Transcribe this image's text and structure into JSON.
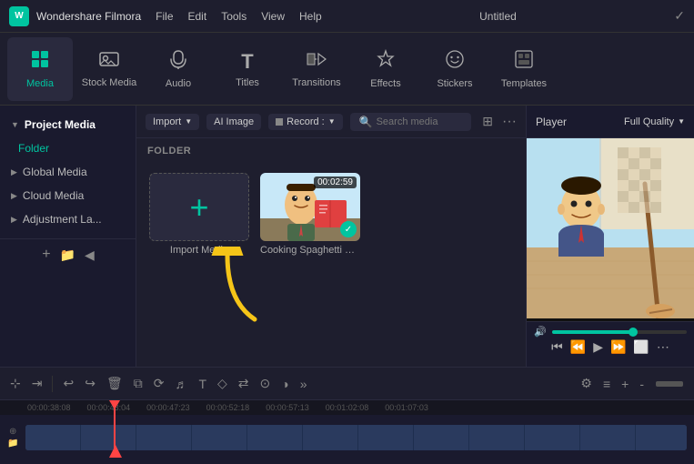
{
  "titlebar": {
    "logo": "W",
    "app_name": "Wondershare Filmora",
    "menu": [
      "File",
      "Edit",
      "Tools",
      "View",
      "Help"
    ],
    "title": "Untitled",
    "verified_icon": "✓"
  },
  "toolbar": {
    "items": [
      {
        "id": "media",
        "icon": "▦",
        "label": "Media",
        "active": true
      },
      {
        "id": "stock_media",
        "icon": "🖼",
        "label": "Stock Media",
        "active": false
      },
      {
        "id": "audio",
        "icon": "♪",
        "label": "Audio",
        "active": false
      },
      {
        "id": "titles",
        "icon": "T",
        "label": "Titles",
        "active": false
      },
      {
        "id": "transitions",
        "icon": "↔",
        "label": "Transitions",
        "active": false
      },
      {
        "id": "effects",
        "icon": "✦",
        "label": "Effects",
        "active": false
      },
      {
        "id": "stickers",
        "icon": "★",
        "label": "Stickers",
        "active": false
      },
      {
        "id": "templates",
        "icon": "⊟",
        "label": "Templates",
        "active": false
      }
    ]
  },
  "sidebar": {
    "sections": [
      {
        "id": "project_media",
        "label": "Project Media",
        "active": true
      },
      {
        "id": "global_media",
        "label": "Global Media"
      },
      {
        "id": "cloud_media",
        "label": "Cloud Media"
      },
      {
        "id": "adjustment",
        "label": "Adjustment La..."
      }
    ],
    "active_sub": "Folder"
  },
  "content_toolbar": {
    "import_label": "Import",
    "ai_image_label": "AI Image",
    "record_label": "Record :",
    "search_placeholder": "Search media",
    "folder_section": "FOLDER"
  },
  "media_items": [
    {
      "id": "import",
      "type": "import",
      "label": "Import Media"
    },
    {
      "id": "video1",
      "type": "video",
      "label": "Cooking Spaghetti _ Mr. Bea...",
      "duration": "00:02:59",
      "checked": true
    }
  ],
  "player": {
    "label": "Player",
    "quality": "Full Quality",
    "progress": 60
  },
  "timeline": {
    "toolbar_buttons": [
      "scissors",
      "undo",
      "redo",
      "trash",
      "crop",
      "speed",
      "audio-wave",
      "text",
      "clock",
      "arrows",
      "filter",
      "color",
      "more-h",
      "settings",
      "keyframe",
      "add-track",
      "minus",
      "divider"
    ],
    "timestamps": [
      "00:00:38:08",
      "00:00:43:04",
      "00:00:47:23",
      "00:00:52:18",
      "00:00:57:13",
      "00:01:02:08",
      "00:01:07:03"
    ]
  },
  "arrow": {
    "color": "#f5c518",
    "symbol": "↑"
  }
}
